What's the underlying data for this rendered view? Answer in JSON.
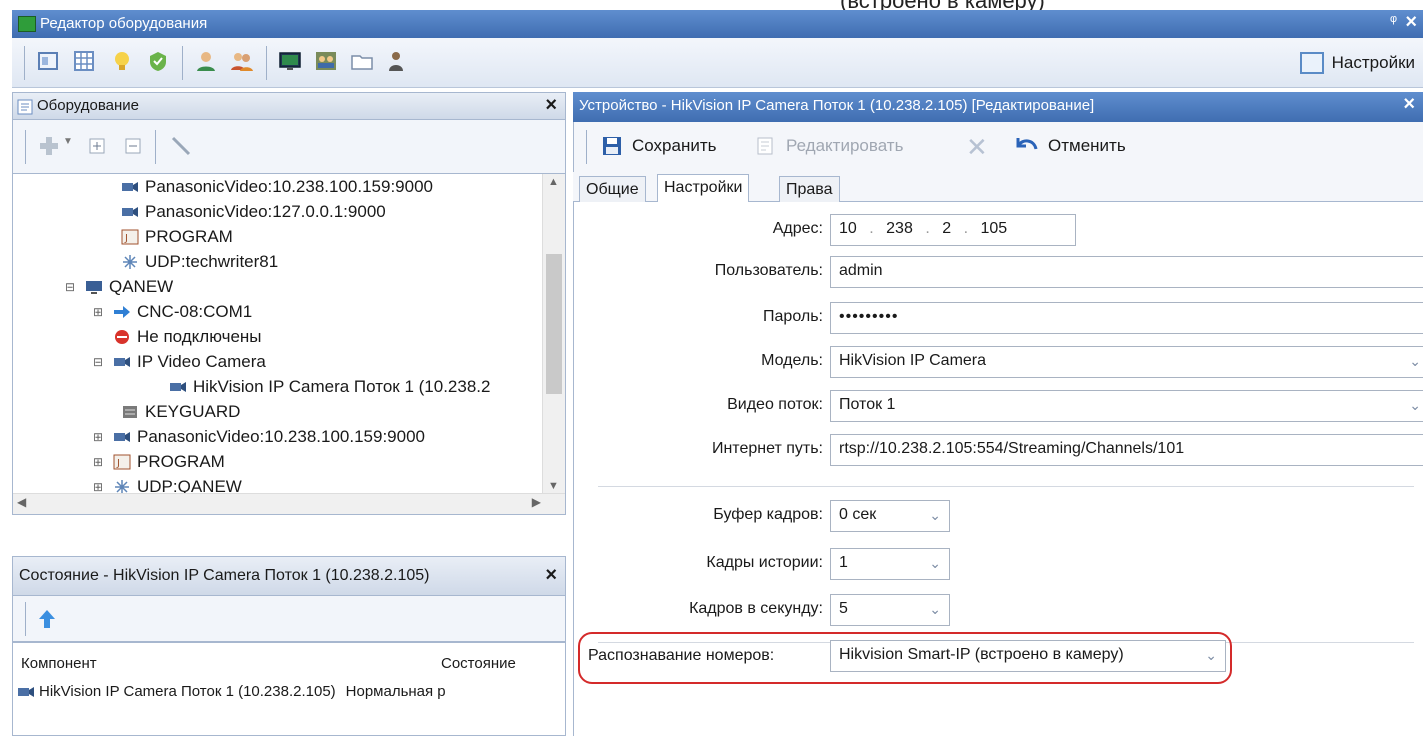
{
  "window": {
    "title": "Редактор оборудования",
    "pin_glyph": "ᵠ",
    "close_glyph": "×",
    "top_cut_text": "(встроено в камеру)"
  },
  "toolbar": {
    "settings_label": "Настройки",
    "icons": [
      "panel-icon",
      "grid-icon",
      "bulb-icon",
      "shield-icon",
      "user-icon",
      "users-icon",
      "monitor-icon",
      "group-icon",
      "folder-icon",
      "person-icon"
    ]
  },
  "equipment_panel": {
    "title": "Оборудование",
    "close_glyph": "×",
    "tree": [
      {
        "label": "PanasonicVideo:10.238.100.159:9000",
        "icon": "camera-icon"
      },
      {
        "label": "PanasonicVideo:127.0.0.1:9000",
        "icon": "camera-icon"
      },
      {
        "label": "PROGRAM",
        "icon": "program-icon"
      },
      {
        "label": "UDP:techwriter81",
        "icon": "network-icon"
      },
      {
        "label": "QANEW",
        "icon": "computer-icon"
      },
      {
        "label": "CNC-08:COM1",
        "icon": "arrow-icon"
      },
      {
        "label": "Не подключены",
        "icon": "stop-icon"
      },
      {
        "label": "IP Video Camera",
        "icon": "camera-icon"
      },
      {
        "label": "HikVision IP Camera Поток 1 (10.238.2",
        "icon": "camera-icon"
      },
      {
        "label": "KEYGUARD",
        "icon": "keyguard-icon"
      },
      {
        "label": "PanasonicVideo:10.238.100.159:9000",
        "icon": "camera-icon"
      },
      {
        "label": "PROGRAM",
        "icon": "program-icon"
      },
      {
        "label": "UDP:QANEW",
        "icon": "network-icon"
      }
    ]
  },
  "state_panel": {
    "title": "Состояние - HikVision IP Camera Поток 1 (10.238.2.105)",
    "close_glyph": "×",
    "columns": [
      "Компонент",
      "Состояние"
    ],
    "rows": [
      {
        "component": "HikVision IP Camera Поток 1 (10.238.2.105)",
        "state": "Нормальная р"
      }
    ]
  },
  "device": {
    "title": "Устройство - HikVision IP Camera Поток 1 (10.238.2.105) [Редактирование]",
    "close_glyph": "×",
    "toolbar": {
      "save": "Сохранить",
      "edit": "Редактировать",
      "cancel": "Отменить"
    },
    "tabs": [
      "Общие",
      "Настройки",
      "Права"
    ],
    "active_tab": "Настройки",
    "form": {
      "address_label": "Адрес:",
      "address": [
        "10",
        "238",
        "2",
        "105"
      ],
      "user_label": "Пользователь:",
      "user_value": "admin",
      "password_label": "Пароль:",
      "password_value": "•••••••••",
      "model_label": "Модель:",
      "model_value": "HikVision IP Camera",
      "stream_label": "Видео поток:",
      "stream_value": "Поток 1",
      "url_label": "Интернет путь:",
      "url_value": "rtsp://10.238.2.105:554/Streaming/Channels/101",
      "buffer_label": "Буфер кадров:",
      "buffer_value": "0 сек",
      "history_label": "Кадры истории:",
      "history_value": "1",
      "fps_label": "Кадров в секунду:",
      "fps_value": "5",
      "lpr_label": "Распознавание номеров:",
      "lpr_value": "Hikvision Smart-IP (встроено в камеру)"
    },
    "highlight_color": "#d42a2a"
  }
}
